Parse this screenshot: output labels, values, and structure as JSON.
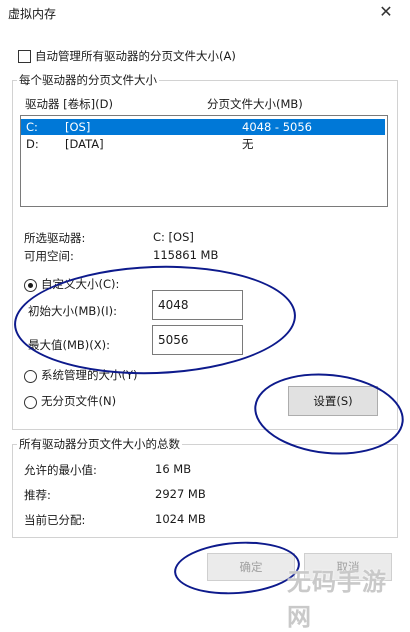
{
  "window": {
    "title": "虚拟内存"
  },
  "auto_manage": {
    "label": "自动管理所有驱动器的分页文件大小(A)",
    "checked": false
  },
  "per_drive": {
    "group_title": "每个驱动器的分页文件大小",
    "columns": [
      "驱动器 [卷标](D)",
      "分页文件大小(MB)"
    ],
    "rows": [
      {
        "drive": "C:",
        "label": "[OS]",
        "size": "4048 - 5056",
        "selected": true
      },
      {
        "drive": "D:",
        "label": "[DATA]",
        "size": "无",
        "selected": false
      }
    ],
    "selected_drive_label": "所选驱动器:",
    "selected_drive_value": "C:  [OS]",
    "free_space_label": "可用空间:",
    "free_space_value": "115861 MB",
    "custom_size_label": "自定义大小(C):",
    "initial_size_label": "初始大小(MB)(I):",
    "initial_size_value": "4048",
    "max_size_label": "最大值(MB)(X):",
    "max_size_value": "5056",
    "system_managed_label": "系统管理的大小(Y)",
    "no_paging_label": "无分页文件(N)",
    "set_button": "设置(S)"
  },
  "totals": {
    "group_title": "所有驱动器分页文件大小的总数",
    "min_label": "允许的最小值:",
    "min_value": "16 MB",
    "recommended_label": "推荐:",
    "recommended_value": "2927 MB",
    "current_label": "当前已分配:",
    "current_value": "1024 MB"
  },
  "buttons": {
    "ok": "确定",
    "cancel": "取消"
  },
  "watermark": "无码手游网",
  "colors": {
    "selection": "#0078d7",
    "annotation_ink": "#0d1a8c"
  }
}
